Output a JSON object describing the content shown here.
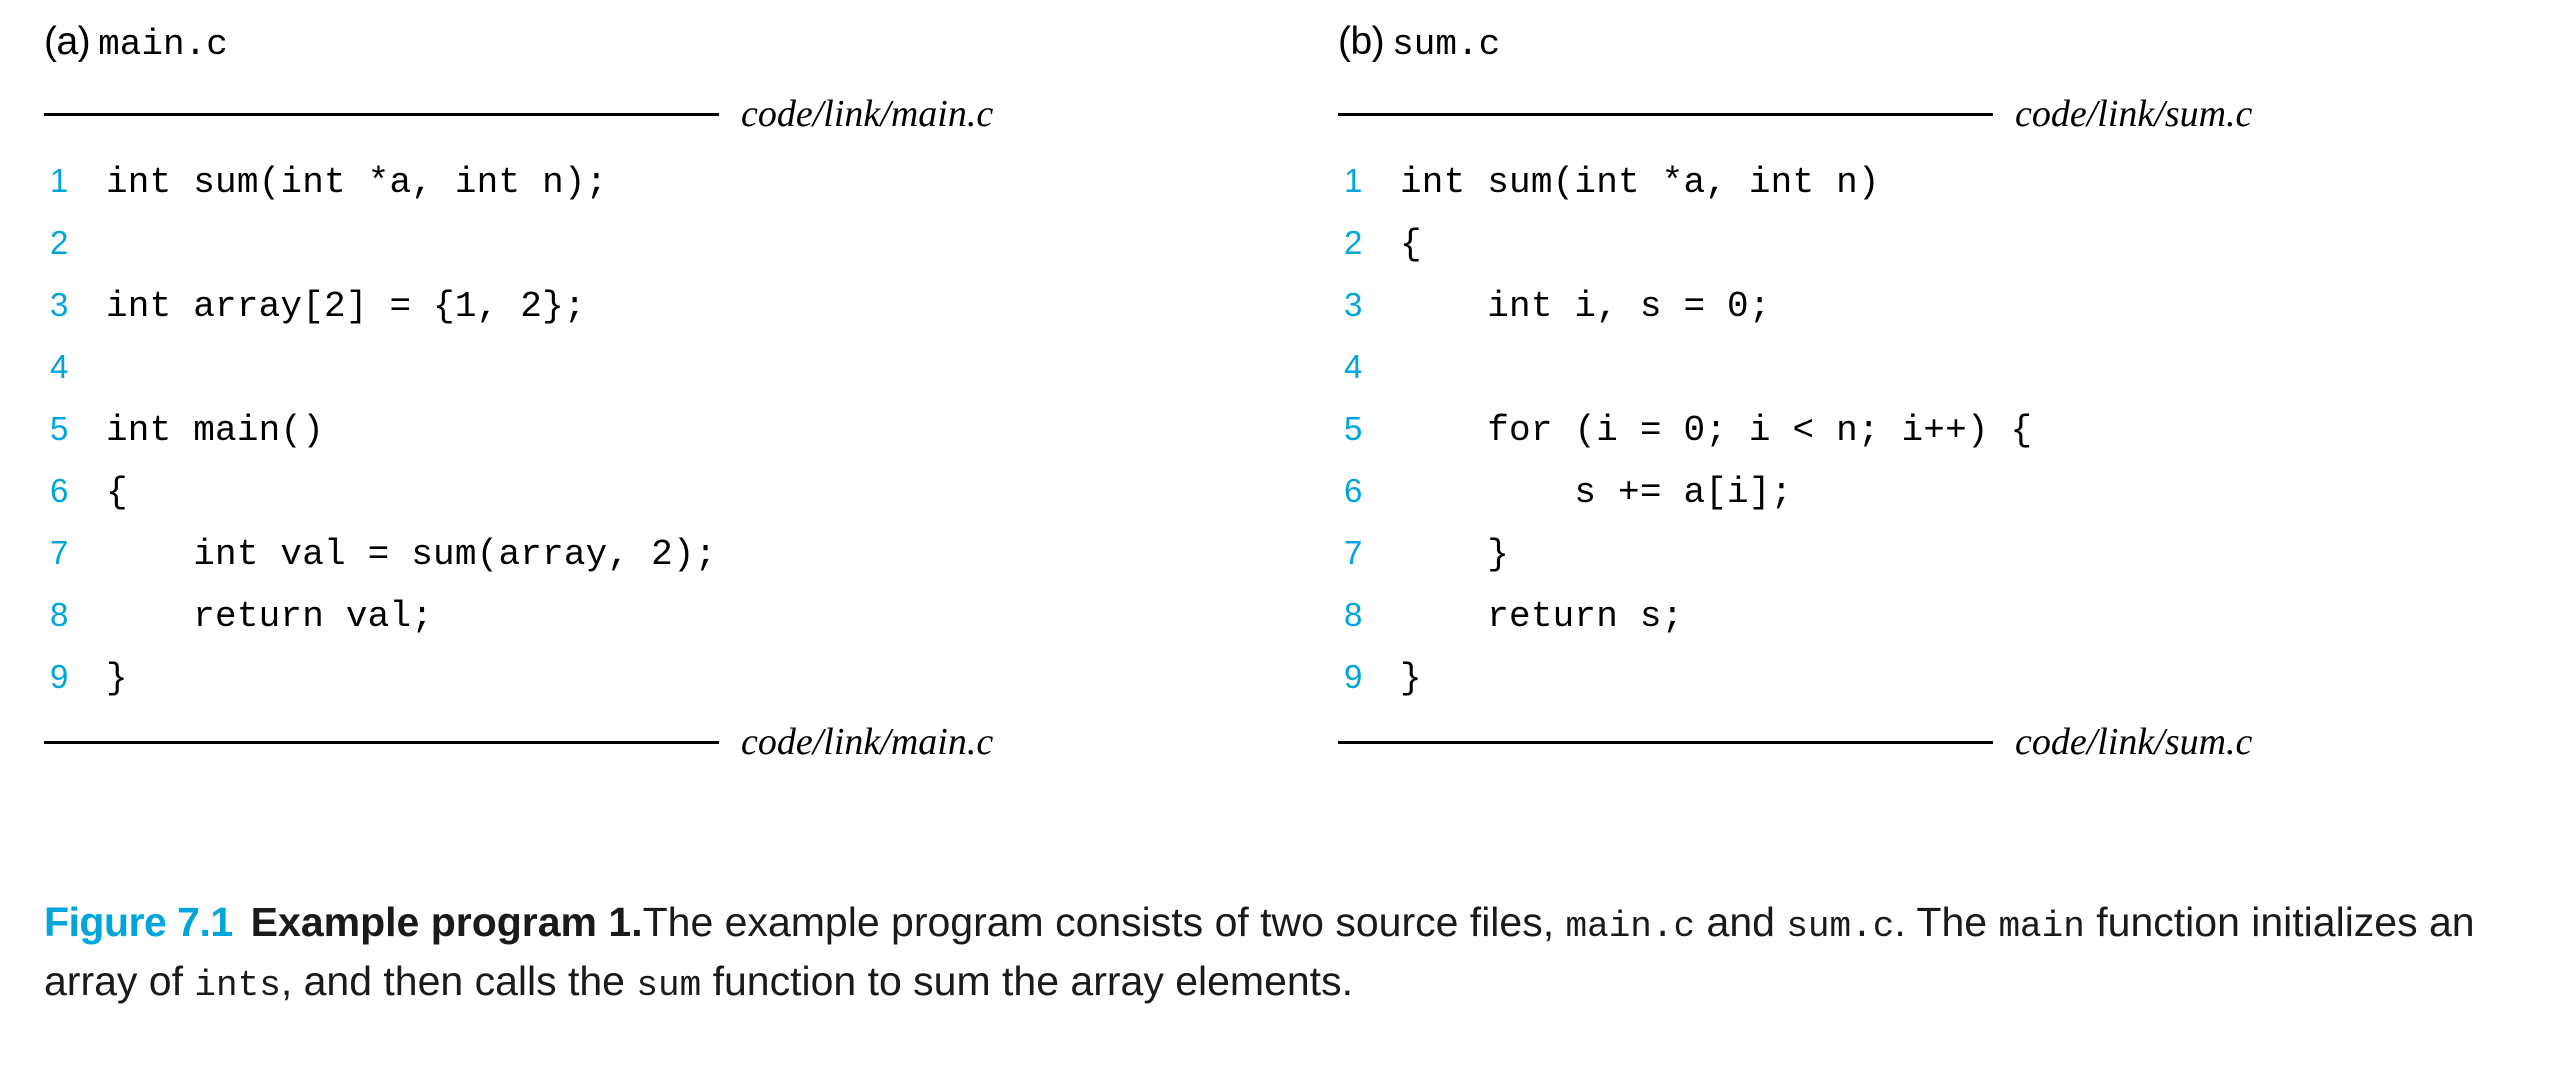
{
  "figure": {
    "number_label": "Figure 7.1",
    "title": "Example program 1.",
    "accent_color": "#00a5dc",
    "body_color": "#1a1a1a",
    "caption_part1": "The example program consists of two source files, ",
    "caption_mono1": "main.c",
    "caption_part2": " and ",
    "caption_mono2": "sum.c",
    "caption_part3": ". The ",
    "caption_mono3": "main",
    "caption_part4": " function initializes an array of ",
    "caption_mono4": "ints",
    "caption_part5": ", and then calls the ",
    "caption_mono5": "sum",
    "caption_part6": " function to sum the array elements."
  },
  "panels": [
    {
      "letter": "(a)",
      "filename": "main.c",
      "path_top": "code/link/main.c",
      "path_bottom": "code/link/main.c",
      "lines": [
        {
          "n": "1",
          "code": "int sum(int *a, int n);"
        },
        {
          "n": "2",
          "code": ""
        },
        {
          "n": "3",
          "code": "int array[2] = {1, 2};"
        },
        {
          "n": "4",
          "code": ""
        },
        {
          "n": "5",
          "code": "int main()"
        },
        {
          "n": "6",
          "code": "{"
        },
        {
          "n": "7",
          "code": "    int val = sum(array, 2);"
        },
        {
          "n": "8",
          "code": "    return val;"
        },
        {
          "n": "9",
          "code": "}"
        }
      ]
    },
    {
      "letter": "(b)",
      "filename": "sum.c",
      "path_top": "code/link/sum.c",
      "path_bottom": "code/link/sum.c",
      "lines": [
        {
          "n": "1",
          "code": "int sum(int *a, int n)"
        },
        {
          "n": "2",
          "code": "{"
        },
        {
          "n": "3",
          "code": "    int i, s = 0;"
        },
        {
          "n": "4",
          "code": ""
        },
        {
          "n": "5",
          "code": "    for (i = 0; i < n; i++) {"
        },
        {
          "n": "6",
          "code": "        s += a[i];"
        },
        {
          "n": "7",
          "code": "    }"
        },
        {
          "n": "8",
          "code": "    return s;"
        },
        {
          "n": "9",
          "code": "}"
        }
      ]
    }
  ]
}
